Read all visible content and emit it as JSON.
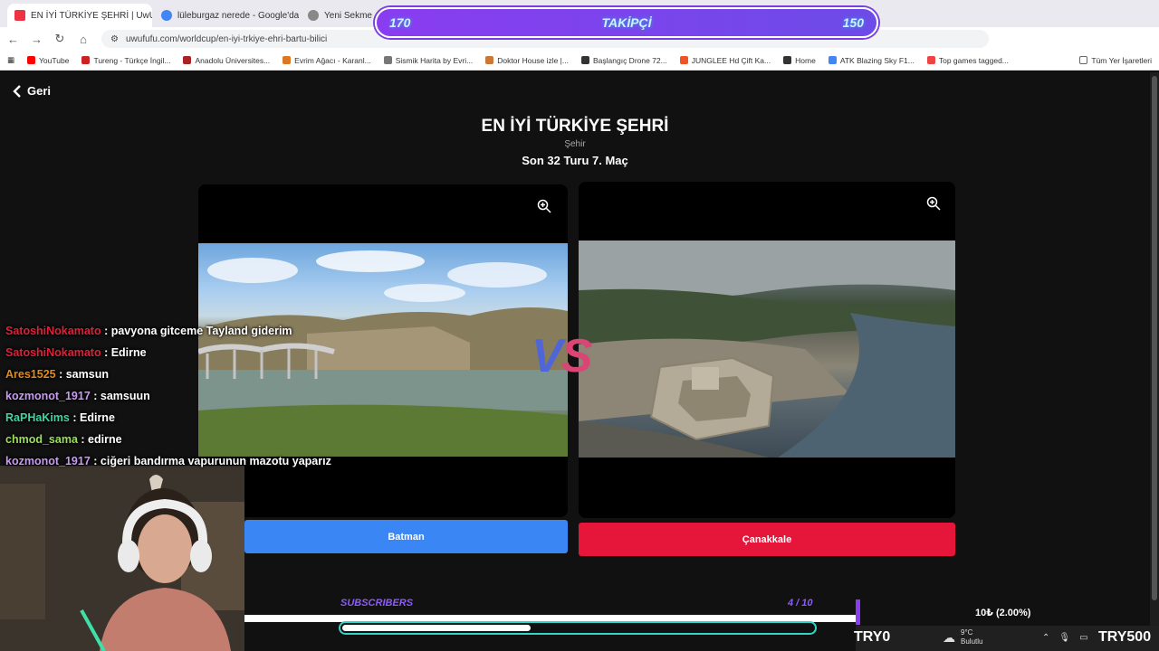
{
  "browser": {
    "tabs": [
      {
        "label": "EN İYİ TÜRKİYE ŞEHRİ | UwUFUFU",
        "active": true,
        "fav_color": "#e34"
      },
      {
        "label": "lüleburgaz nerede - Google'da",
        "active": false,
        "fav_color": "#4285f4"
      },
      {
        "label": "Yeni Sekme",
        "active": false,
        "fav_color": "#888"
      }
    ],
    "url": "uwufufu.com/worldcup/en-iyi-trkiye-ehri-bartu-bilici",
    "bookmarks": [
      {
        "label": "YouTube",
        "color": "#f00"
      },
      {
        "label": "Tureng - Türkçe İngil...",
        "color": "#c22"
      },
      {
        "label": "Anadolu Üniversites...",
        "color": "#a22"
      },
      {
        "label": "Evrim Ağacı - Karanl...",
        "color": "#d72"
      },
      {
        "label": "Sismik Harita by Evri...",
        "color": "#777"
      },
      {
        "label": "Doktor House izle |...",
        "color": "#c73"
      },
      {
        "label": "Başlangıç Drone 72...",
        "color": "#333"
      },
      {
        "label": "JUNGLEE Hd Çift Ka...",
        "color": "#e52"
      },
      {
        "label": "Home",
        "color": "#333"
      },
      {
        "label": "ATK Blazing Sky F1...",
        "color": "#4285f4"
      },
      {
        "label": "Top games tagged...",
        "color": "#e44"
      }
    ],
    "all_bookmarks": "Tüm Yer İşaretleri"
  },
  "overlay": {
    "follow_label": "TAKİPÇİ",
    "follow_current": "170",
    "follow_goal": "150",
    "subs_label": "SUBSCRIBERS",
    "subs_count": "4 / 10",
    "subs_progress": 0.4,
    "donation": "10₺ (2.00%)",
    "try_left": "TRY0",
    "try_right": "TRY500"
  },
  "page": {
    "back_label": "Geri",
    "title": "EN İYİ TÜRKİYE ŞEHRİ",
    "category": "Şehir",
    "round": "Son 32 Turu 7. Maç",
    "vs_v": "V",
    "vs_s": "S",
    "left_choice": "Batman",
    "right_choice": "Çanakkale"
  },
  "chat": [
    {
      "user": "SatoshiNokamato",
      "color": "#e0203a",
      "text": ": pavyona gitceme Tayland giderim"
    },
    {
      "user": "SatoshiNokamato",
      "color": "#e0203a",
      "text": ": Edirne"
    },
    {
      "user": "Ares1525",
      "color": "#e08a1e",
      "text": ": samsun"
    },
    {
      "user": "kozmonot_1917",
      "color": "#c89cf0",
      "text": ": samsuun"
    },
    {
      "user": "RaPHaKims",
      "color": "#3fd4a4",
      "text": ": Edirne"
    },
    {
      "user": "chmod_sama",
      "color": "#9be05a",
      "text": ": edirne"
    },
    {
      "user": "kozmonot_1917",
      "color": "#c89cf0",
      "text": ": ciğeri bandırma vapurunun mazotu yaparız"
    }
  ],
  "taskbar": {
    "temp": "9°C",
    "weather": "Bulutlu"
  }
}
